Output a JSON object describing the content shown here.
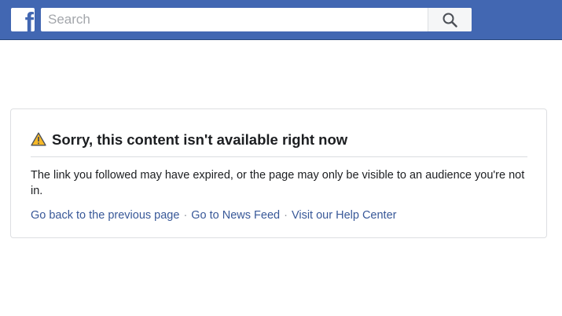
{
  "header": {
    "logo_letter": "f",
    "search": {
      "placeholder": "Search",
      "value": ""
    },
    "brand_color": "#4267b2"
  },
  "error_card": {
    "title": "Sorry, this content isn't available right now",
    "message": "The link you followed may have expired, or the page may only be visible to an audience you're not in.",
    "links": [
      {
        "label": "Go back to the previous page"
      },
      {
        "label": "Go to News Feed"
      },
      {
        "label": "Visit our Help Center"
      }
    ],
    "separator": "·",
    "link_color": "#385898",
    "warning_icon": "warning-triangle-icon"
  }
}
